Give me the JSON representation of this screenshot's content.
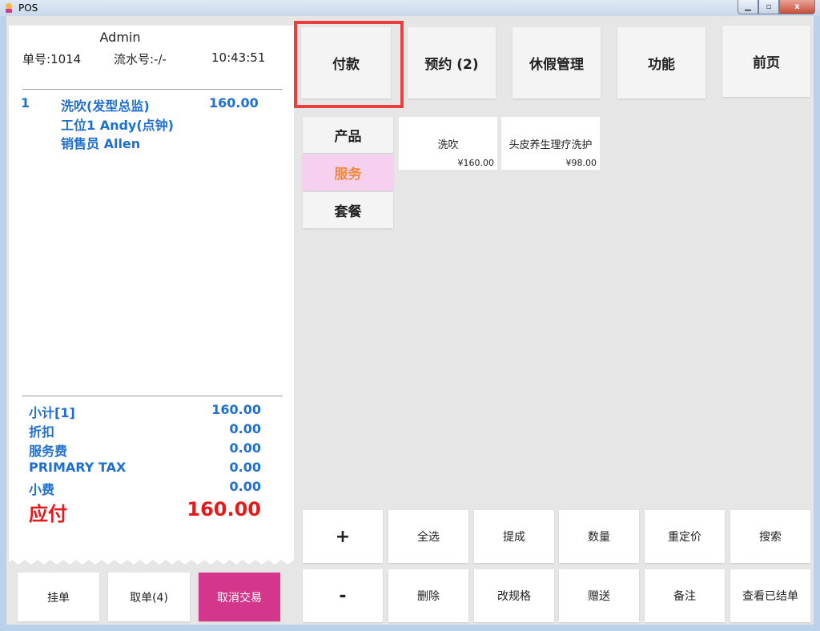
{
  "window": {
    "title": "POS",
    "minimize": "▁",
    "maximize": "▫",
    "close": "x"
  },
  "receipt": {
    "user": "Admin",
    "order_no": "单号:1014",
    "serial_no": "流水号:-/-",
    "time": "10:43:51",
    "line": {
      "index": "1",
      "name": "洗吹(发型总监)",
      "price": "160.00",
      "station": "工位1  Andy(点钟)",
      "seller": "销售员  Allen"
    },
    "totals": [
      {
        "label": "小计[1]",
        "value": "160.00"
      },
      {
        "label": "折扣",
        "value": "0.00"
      },
      {
        "label": "服务费",
        "value": "0.00"
      },
      {
        "label": "PRIMARY TAX",
        "value": "0.00"
      },
      {
        "label": "小费",
        "value": "0.00"
      }
    ],
    "due_label": "应付",
    "due_value": "160.00"
  },
  "receipt_actions": {
    "hold": "挂单",
    "retrieve": "取单(4)",
    "cancel": "取消交易"
  },
  "top_nav": {
    "pay": "付款",
    "booking": "预约 (2)",
    "leave": "休假管理",
    "functions": "功能",
    "front": "前页"
  },
  "categories": {
    "products": "产品",
    "services": "服务",
    "packages": "套餐"
  },
  "products": [
    {
      "name": "洗吹",
      "price": "¥160.00"
    },
    {
      "name": "头皮养生理疗洗护",
      "price": "¥98.00"
    }
  ],
  "actions": {
    "plus": "+",
    "select_all": "全选",
    "commission": "提成",
    "quantity": "数量",
    "reprice": "重定价",
    "search": "搜索",
    "minus": "-",
    "delete": "删除",
    "change_spec": "改规格",
    "gift": "赠送",
    "remark": "备注",
    "view_settled": "查看已结单"
  },
  "colors": {
    "accent_blue": "#1e6fd0",
    "due_red": "#e21a1a",
    "cancel_pink": "#d3368b",
    "active_category_bg": "#f6d1ef",
    "active_category_text": "#f08a3a",
    "highlight_border": "#ee3d3d"
  }
}
